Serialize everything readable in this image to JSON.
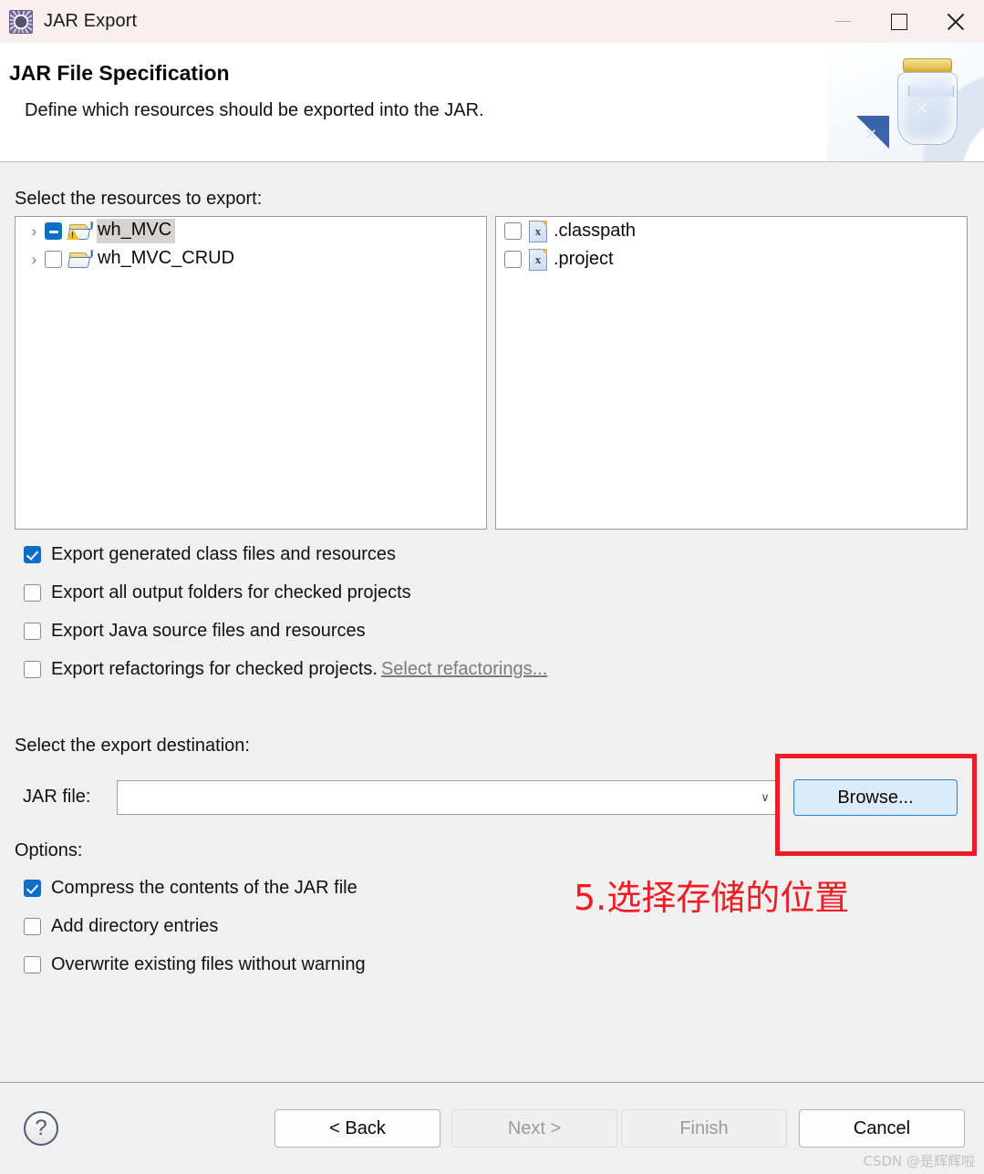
{
  "window": {
    "title": "JAR Export",
    "app_icon": "jar-export-gear-icon",
    "controls": {
      "minimize": "—",
      "maximize": "□",
      "close": "✕"
    },
    "titlebar_color": "#faeff0"
  },
  "header": {
    "title": "JAR File Specification",
    "subtitle": "Define which resources should be exported into the JAR.",
    "banner_icon": "jar-with-arrow-icon"
  },
  "resources": {
    "label": "Select the resources to export:",
    "tree": [
      {
        "name": "wh_MVC",
        "twisty": "›",
        "check_state": "partial",
        "selected": true,
        "icon": "java-project-folder-warning-icon"
      },
      {
        "name": "wh_MVC_CRUD",
        "twisty": "›",
        "check_state": "unchecked",
        "selected": false,
        "icon": "java-project-folder-icon"
      }
    ],
    "files": [
      {
        "name": ".classpath",
        "check_state": "unchecked",
        "icon": "xml-file-icon",
        "glyph": "x"
      },
      {
        "name": ".project",
        "check_state": "unchecked",
        "icon": "xml-file-icon",
        "glyph": "x"
      }
    ]
  },
  "export_options": [
    {
      "label": "Export generated class files and resources",
      "checked": true,
      "link": null
    },
    {
      "label": "Export all output folders for checked projects",
      "checked": false,
      "link": null
    },
    {
      "label": "Export Java source files and resources",
      "checked": false,
      "link": null
    },
    {
      "label": "Export refactorings for checked projects.",
      "checked": false,
      "link": "Select refactorings..."
    }
  ],
  "destination": {
    "label": "Select the export destination:",
    "jar_file_label": "JAR file:",
    "jar_file_value": "",
    "jar_file_placeholder": "",
    "combo_chevron": "∨",
    "browse_label": "Browse...",
    "browse_focus_color": "#2680d2"
  },
  "options": {
    "label": "Options:",
    "items": [
      {
        "label": "Compress the contents of the JAR file",
        "checked": true
      },
      {
        "label": "Add directory entries",
        "checked": false
      },
      {
        "label": "Overwrite existing files without warning",
        "checked": false
      }
    ]
  },
  "annotation": {
    "text": "5.选择存储的位置",
    "color": "#f01c24",
    "box_color": "#ee1c25"
  },
  "footer": {
    "help_glyph": "?",
    "buttons": [
      {
        "label": "< Back",
        "enabled": true
      },
      {
        "label": "Next >",
        "enabled": false
      },
      {
        "label": "Finish",
        "enabled": false
      },
      {
        "label": "Cancel",
        "enabled": true
      }
    ]
  },
  "watermark": "CSDN @是辉辉啦"
}
